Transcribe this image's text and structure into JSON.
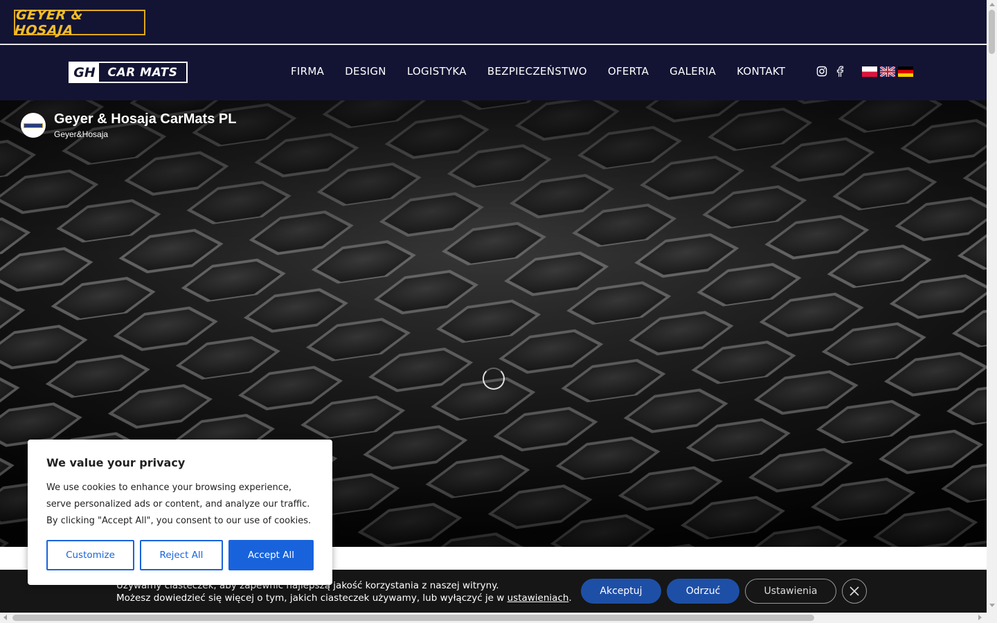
{
  "brand": {
    "name": "GEYER & HOSAJA"
  },
  "nav": {
    "logo_mark": "GH",
    "logo_text": "CAR MATS",
    "items": [
      "FIRMA",
      "DESIGN",
      "LOGISTYKA",
      "BEZPIECZEŃSTWO",
      "OFERTA",
      "GALERIA",
      "KONTAKT"
    ],
    "social": [
      "instagram-icon",
      "facebook-icon"
    ],
    "languages": [
      "pl",
      "en",
      "de"
    ]
  },
  "video": {
    "channel_title": "Geyer & Hosaja CarMats PL",
    "channel_subtitle": "Geyer&Hosaja"
  },
  "privacy": {
    "title": "We value your privacy",
    "text": "We use cookies to enhance your browsing experience, serve personalized ads or content, and analyze our traffic. By clicking \"Accept All\", you consent to our use of cookies.",
    "customize": "Customize",
    "reject": "Reject All",
    "accept": "Accept All"
  },
  "cookie_bar": {
    "line1": "Używamy ciasteczek, aby zapewnić najlepszą jakość korzystania z naszej witryny.",
    "line2_prefix": "Możesz dowiedzieć się więcej o tym, jakich ciasteczek używamy, lub wyłączyć je w ",
    "line2_link": "ustawieniach",
    "line2_suffix": ".",
    "accept": "Akceptuj",
    "reject": "Odrzuć",
    "settings": "Ustawienia"
  },
  "colors": {
    "header_bg": "#131434",
    "brand_yellow": "#f2bd2a",
    "accent_blue": "#1863dc",
    "cookie_bar_bg": "#161616"
  }
}
